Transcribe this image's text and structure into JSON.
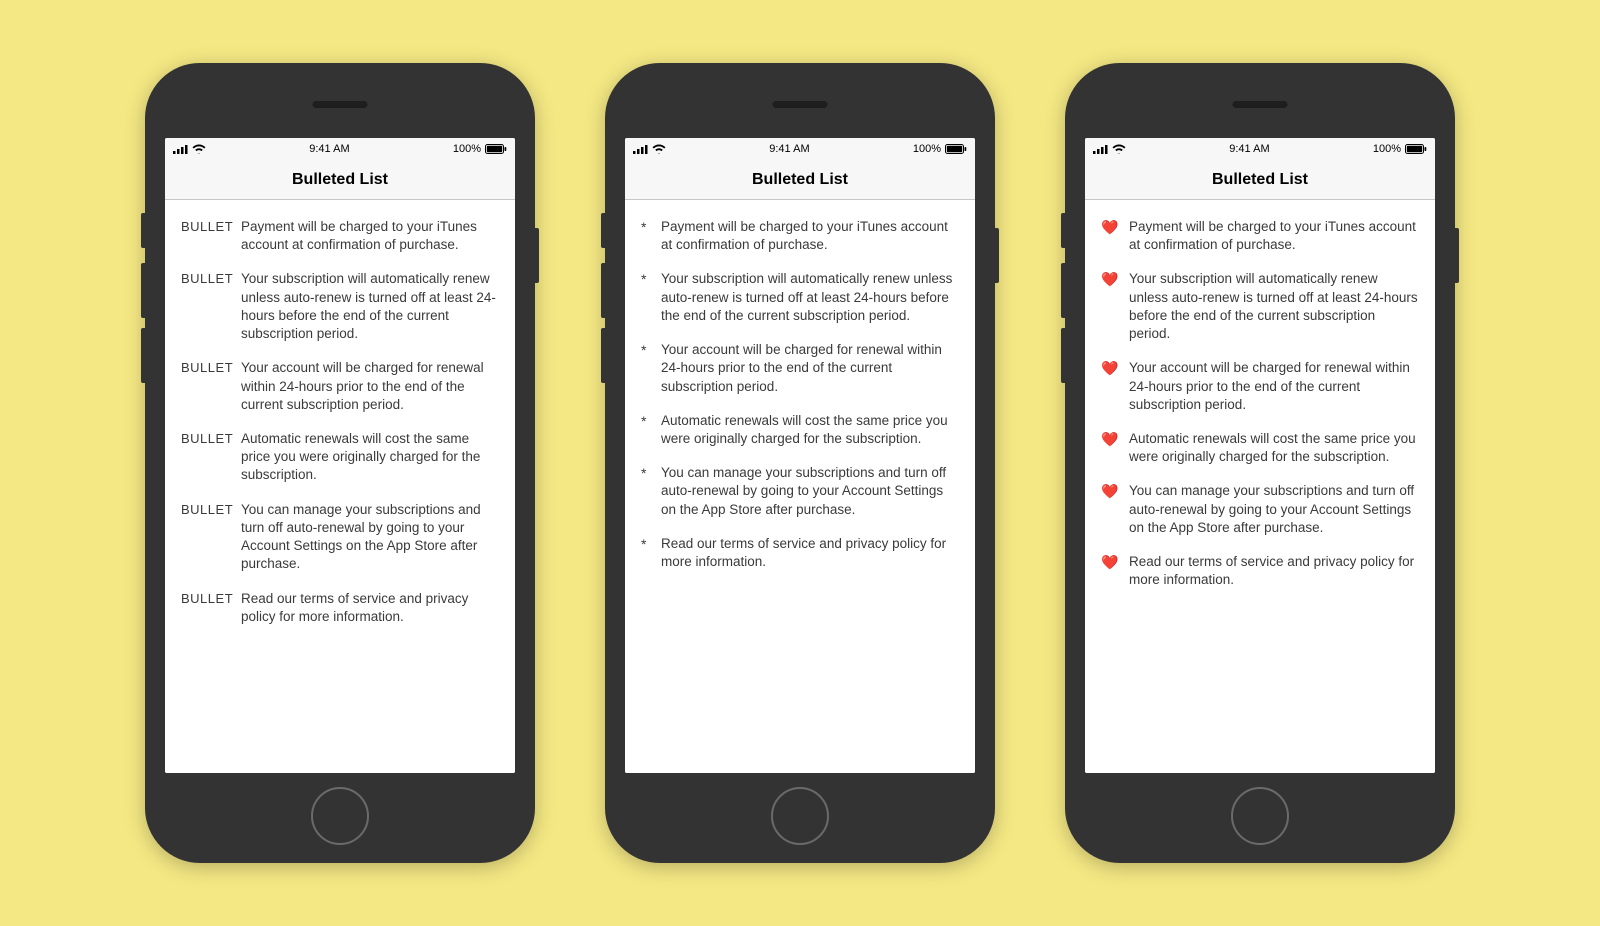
{
  "status": {
    "time": "9:41 AM",
    "battery_pct": "100%"
  },
  "nav_title": "Bulleted List",
  "bullets": {
    "phone1": "BULLET",
    "phone2": "*",
    "phone3": "❤️"
  },
  "items": [
    "Payment will be charged to your iTunes account at confirmation of purchase.",
    "Your subscription will automatically renew unless auto-renew is turned off at least 24-hours before the end of the current subscription period.",
    "Your account will be charged for renewal within 24-hours prior to the end of the current subscription period.",
    "Automatic renewals will cost the same price you were originally charged for the subscription.",
    "You can manage your subscriptions and turn off auto-renewal by going to your Account Settings on the App Store after purchase.",
    "Read our terms of service and privacy policy for more information."
  ]
}
